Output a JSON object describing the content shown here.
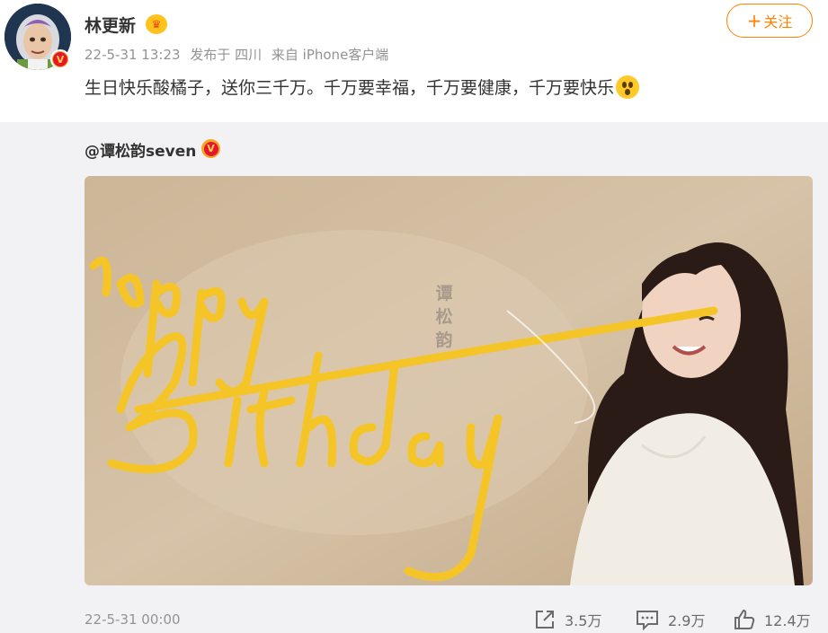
{
  "post": {
    "author": {
      "name": "林更新",
      "avatar_icon": "buzz-lightyear-avatar",
      "verified_icon": "verified-v-icon",
      "member_icon": "crown-icon"
    },
    "meta": {
      "time": "22-5-31 13:23",
      "location": "发布于 四川",
      "source": "来自 iPhone客户端"
    },
    "follow_label": "关注",
    "text": "生日快乐酸橘子，送你三千万。千万要幸福，千万要健康，千万要快乐",
    "emoji": "shocked-emoji"
  },
  "repost": {
    "original_author": "@谭松韵seven",
    "verified_icon": "verified-v-icon",
    "image": {
      "description_icon": "birthday-photo",
      "lettering": "Happy Birthday",
      "vertical_name": "谭松韵",
      "colors": {
        "background": "#c9b59a",
        "lettering": "#f5c527"
      }
    },
    "time": "22-5-31 00:00",
    "actions": {
      "repost_count": "3.5万",
      "comment_count": "2.9万",
      "like_count": "12.4万"
    }
  },
  "colors": {
    "accent": "#ff8200",
    "muted_text": "#939393",
    "repost_bg": "#f2f2f4"
  }
}
